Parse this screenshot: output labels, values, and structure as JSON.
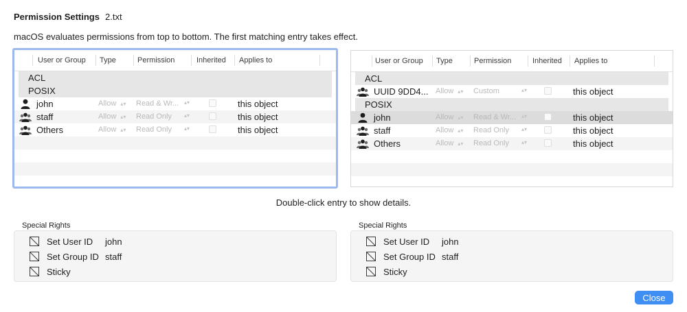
{
  "header": {
    "title": "Permission Settings",
    "filename": "2.txt"
  },
  "description": "macOS evaluates permissions from top to bottom. The first matching entry takes effect.",
  "columns": [
    "User or Group",
    "Type",
    "Permission",
    "Inherited",
    "Applies to"
  ],
  "left_table": {
    "rows": [
      {
        "kind": "section",
        "label": "ACL"
      },
      {
        "kind": "section",
        "label": "POSIX"
      },
      {
        "kind": "entry",
        "icon": "user-icon",
        "name": "john",
        "type": "Allow",
        "permission": "Read & Wr...",
        "applies": "this object"
      },
      {
        "kind": "entry",
        "icon": "group-icon",
        "name": "staff",
        "type": "Allow",
        "permission": "Read Only",
        "applies": "this object"
      },
      {
        "kind": "entry",
        "icon": "group-icon",
        "name": "Others",
        "type": "Allow",
        "permission": "Read Only",
        "applies": "this object"
      }
    ]
  },
  "right_table": {
    "rows": [
      {
        "kind": "section",
        "label": "ACL"
      },
      {
        "kind": "entry",
        "icon": "group-icon",
        "name": "UUID 9DD4...",
        "type": "Allow",
        "permission": "Custom",
        "applies": "this object"
      },
      {
        "kind": "section",
        "label": "POSIX"
      },
      {
        "kind": "entry",
        "icon": "user-icon",
        "name": "john",
        "type": "Allow",
        "permission": "Read & Wr...",
        "applies": "this object",
        "selected": true
      },
      {
        "kind": "entry",
        "icon": "group-icon",
        "name": "staff",
        "type": "Allow",
        "permission": "Read Only",
        "applies": "this object"
      },
      {
        "kind": "entry",
        "icon": "group-icon",
        "name": "Others",
        "type": "Allow",
        "permission": "Read Only",
        "applies": "this object"
      }
    ]
  },
  "hint": "Double-click entry to show details.",
  "special_rights": [
    {
      "title": "Special Rights",
      "items": [
        {
          "label": "Set User ID",
          "value": "john"
        },
        {
          "label": "Set Group ID",
          "value": "staff"
        },
        {
          "label": "Sticky",
          "value": ""
        }
      ]
    },
    {
      "title": "Special Rights",
      "items": [
        {
          "label": "Set User ID",
          "value": "john"
        },
        {
          "label": "Set Group ID",
          "value": "staff"
        },
        {
          "label": "Sticky",
          "value": ""
        }
      ]
    }
  ],
  "close_button": "Close",
  "colors": {
    "accent": "#3f8ef4",
    "focus_ring": "#9ab9ee",
    "selected_row": "#dcdcdc"
  }
}
